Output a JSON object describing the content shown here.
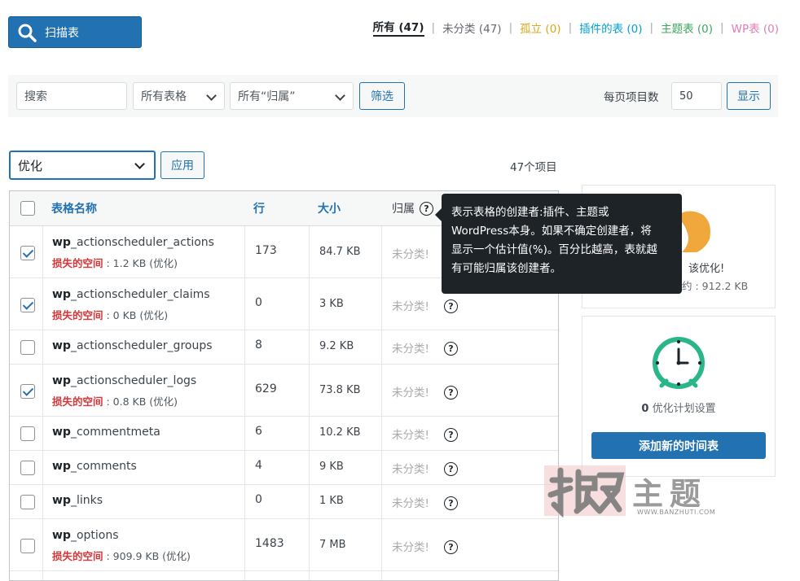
{
  "toolbar": {
    "scan_label": "扫描表"
  },
  "filters": {
    "all": "所有 (47)",
    "uncategorized": "未分类 (47)",
    "orphan": "孤立 (0)",
    "plugin_tables": "插件的表 (0)",
    "theme_tables": "主题表 (0)",
    "wp_tables": "WP表 (0)",
    "colors": {
      "uncategorized": "#646970",
      "orphan": "#dba617",
      "plugin": "#00a0d2",
      "theme": "#3ca85d",
      "wp": "#e07db8"
    }
  },
  "search": {
    "placeholder": "搜索",
    "table_select": "所有表格",
    "owner_select": "所有“归属”",
    "filter_button": "筛选",
    "per_page_label": "每页项目数",
    "per_page_value": "50",
    "show_button": "显示"
  },
  "bulk": {
    "action": "优化",
    "apply": "应用",
    "item_count": "47个项目"
  },
  "table": {
    "headers": {
      "name": "表格名称",
      "rows": "行",
      "size": "大小",
      "owner": "归属"
    },
    "lost_label": "损失的空间",
    "rows": [
      {
        "prefix": "wp",
        "name": "_actionscheduler_actions",
        "rows": "173",
        "size": "84.7 KB",
        "owner": "未分类!",
        "checked": true,
        "lost": " : 1.2 KB (优化)"
      },
      {
        "prefix": "wp",
        "name": "_actionscheduler_claims",
        "rows": "0",
        "size": "3 KB",
        "owner": "未分类!",
        "checked": true,
        "lost": " : 0 KB (优化)"
      },
      {
        "prefix": "wp",
        "name": "_actionscheduler_groups",
        "rows": "8",
        "size": "9.2 KB",
        "owner": "未分类!",
        "checked": false,
        "lost": ""
      },
      {
        "prefix": "wp",
        "name": "_actionscheduler_logs",
        "rows": "629",
        "size": "73.8 KB",
        "owner": "未分类!",
        "checked": true,
        "lost": " : 0.8 KB (优化)"
      },
      {
        "prefix": "wp",
        "name": "_commentmeta",
        "rows": "6",
        "size": "10.2 KB",
        "owner": "未分类!",
        "checked": false,
        "lost": ""
      },
      {
        "prefix": "wp",
        "name": "_comments",
        "rows": "4",
        "size": "9 KB",
        "owner": "未分类!",
        "checked": false,
        "lost": ""
      },
      {
        "prefix": "wp",
        "name": "_links",
        "rows": "0",
        "size": "1 KB",
        "owner": "未分类!",
        "checked": false,
        "lost": ""
      },
      {
        "prefix": "wp",
        "name": "_options",
        "rows": "1483",
        "size": "7 MB",
        "owner": "未分类!",
        "checked": false,
        "lost": " : 909.9 KB (优化)"
      }
    ]
  },
  "tooltip": {
    "lines": [
      "表示表格的创建者:插件、主题或",
      "WordPress本身。如果不确定创建者，将",
      "显示一个估计值(%)。百分比越高，表就越",
      "有可能归属该创建者。"
    ]
  },
  "panel_optimize": {
    "title": "该优化!",
    "subtitle": "约 : 912.2 KB"
  },
  "panel_schedule": {
    "count": "0",
    "label": " 优化计划设置",
    "add_button": "添加新的时间表"
  },
  "watermark": {
    "text": "主题",
    "url": "WWW.BANZHUTI.COM"
  },
  "icons": {
    "scan": "search-icon",
    "help": "question-icon",
    "clock": "clock-icon",
    "bell": "bell-icon"
  }
}
